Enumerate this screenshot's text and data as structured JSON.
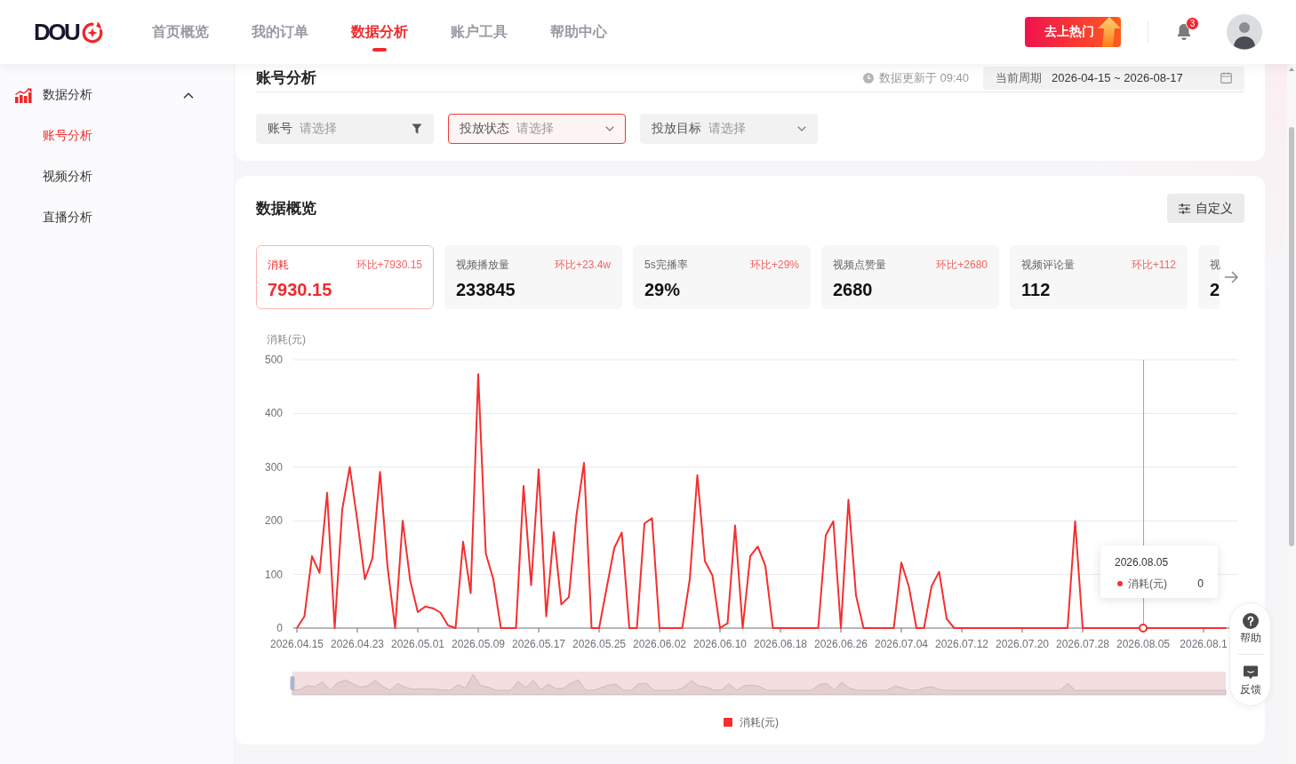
{
  "header": {
    "logo": "DOU",
    "nav": [
      {
        "label": "首页概览",
        "selected": false
      },
      {
        "label": "我的订单",
        "selected": false
      },
      {
        "label": "数据分析",
        "selected": true
      },
      {
        "label": "账户工具",
        "selected": false
      },
      {
        "label": "帮助中心",
        "selected": false
      }
    ],
    "promo_button": "去上热门",
    "notification_badge": "3"
  },
  "sidebar": {
    "groups": [
      {
        "label": "数据分析",
        "expanded": true,
        "children": [
          {
            "label": "账号分析",
            "selected": true
          },
          {
            "label": "视频分析",
            "selected": false
          },
          {
            "label": "直播分析",
            "selected": false
          }
        ]
      }
    ]
  },
  "account_panel": {
    "title": "账号分析",
    "updated": "数据更新于 09:40",
    "period_label": "当前周期",
    "period": "2026-04-15 ~ 2026-08-17",
    "filters": [
      {
        "kind": "filter",
        "label": "账号",
        "placeholder": "请选择",
        "active": false
      },
      {
        "kind": "dropdown",
        "label": "投放状态",
        "placeholder": "请选择",
        "active": true
      },
      {
        "kind": "dropdown",
        "label": "投放目标",
        "placeholder": "请选择",
        "active": false
      }
    ]
  },
  "overview": {
    "title": "数据概览",
    "customize_button": "自定义",
    "metrics": [
      {
        "label": "消耗",
        "change": "环比+7930.15",
        "value": "7930.15",
        "selected": true
      },
      {
        "label": "视频播放量",
        "change": "环比+23.4w",
        "value": "233845",
        "selected": false
      },
      {
        "label": "5s完播率",
        "change": "环比+29%",
        "value": "29%",
        "selected": false
      },
      {
        "label": "视频点赞量",
        "change": "环比+2680",
        "value": "2680",
        "selected": false
      },
      {
        "label": "视频评论量",
        "change": "环比+112",
        "value": "112",
        "selected": false
      },
      {
        "label": "视",
        "value": "2",
        "selected": false
      }
    ],
    "chart": {
      "chart_data": {
        "type": "line",
        "ylabel": "消耗(元)",
        "categories": [
          "2026.04.15",
          null,
          null,
          null,
          null,
          null,
          null,
          null,
          "2026.04.23",
          null,
          null,
          null,
          null,
          null,
          null,
          null,
          "2026.05.01",
          null,
          null,
          null,
          null,
          null,
          null,
          null,
          "2026.05.09",
          null,
          null,
          null,
          null,
          null,
          null,
          null,
          "2026.05.17",
          null,
          null,
          null,
          null,
          null,
          null,
          null,
          "2026.05.25",
          null,
          null,
          null,
          null,
          null,
          null,
          null,
          "2026.06.02",
          null,
          null,
          null,
          null,
          null,
          null,
          null,
          "2026.06.10",
          null,
          null,
          null,
          null,
          null,
          null,
          null,
          "2026.06.18",
          null,
          null,
          null,
          null,
          null,
          null,
          null,
          "2026.06.26",
          null,
          null,
          null,
          null,
          null,
          null,
          null,
          "2026.07.04",
          null,
          null,
          null,
          null,
          null,
          null,
          null,
          "2026.07.12",
          null,
          null,
          null,
          null,
          null,
          null,
          null,
          "2026.07.20",
          null,
          null,
          null,
          null,
          null,
          null,
          null,
          "2026.07.28",
          null,
          null,
          null,
          null,
          null,
          null,
          null,
          "2026.08.05",
          null,
          null,
          null,
          null,
          null,
          null,
          null,
          "2026.08.1",
          null,
          null,
          null,
          null
        ],
        "series": [
          {
            "name": "消耗(元)",
            "color": "#f52f2f",
            "values": [
              0,
              22,
              134,
              103,
              252,
              0,
              221,
              300,
              200,
              91,
              130,
              291,
              114,
              0,
              200,
              88,
              30,
              40,
              37,
              29,
              5,
              0,
              161,
              65,
              473,
              139,
              91,
              0,
              0,
              0,
              265,
              80,
              296,
              22,
              179,
              44,
              58,
              210,
              308,
              0,
              0,
              75,
              149,
              178,
              0,
              0,
              195,
              205,
              0,
              0,
              0,
              0,
              91,
              285,
              125,
              98,
              0,
              9,
              191,
              0,
              134,
              152,
              116,
              0,
              0,
              0,
              0,
              0,
              0,
              0,
              173,
              199,
              0,
              239,
              61,
              0,
              0,
              0,
              0,
              0,
              122,
              77,
              0,
              0,
              78,
              105,
              17,
              0,
              0,
              0,
              0,
              0,
              0,
              0,
              0,
              0,
              0,
              0,
              0,
              0,
              0,
              0,
              0,
              199,
              0,
              0,
              0,
              0,
              0,
              0,
              0,
              0,
              0,
              0,
              0,
              0,
              0,
              0,
              0,
              0,
              0,
              0,
              0,
              0,
              null
            ]
          }
        ],
        "ylim": [
          0,
          500
        ],
        "yticks": [
          0,
          100,
          200,
          300,
          400,
          500
        ],
        "grid": true
      },
      "tooltip": {
        "date": "2026.08.05",
        "series": "消耗(元)",
        "value": "0"
      }
    }
  },
  "help_widget": [
    {
      "kind": "help",
      "label": "帮助"
    },
    {
      "kind": "feedback",
      "label": "反馈"
    }
  ]
}
